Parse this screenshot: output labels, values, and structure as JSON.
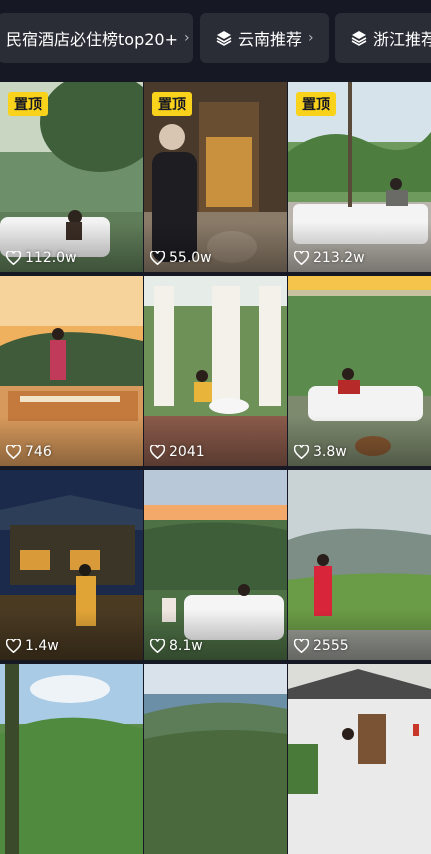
{
  "chips": [
    {
      "label": "民宿酒店必住榜top20+",
      "icon": "chevron-right-icon"
    },
    {
      "label": "云南推荐",
      "icon": "layers-icon"
    },
    {
      "label": "浙江推荐",
      "icon": "layers-icon"
    }
  ],
  "pinned_label": "置顶",
  "tiles": [
    {
      "likes": "112.0w",
      "pinned": true
    },
    {
      "likes": "55.0w",
      "pinned": true
    },
    {
      "likes": "213.2w",
      "pinned": true
    },
    {
      "likes": "746",
      "pinned": false
    },
    {
      "likes": "2041",
      "pinned": false
    },
    {
      "likes": "3.8w",
      "pinned": false
    },
    {
      "likes": "1.4w",
      "pinned": false
    },
    {
      "likes": "8.1w",
      "pinned": false
    },
    {
      "likes": "2555",
      "pinned": false
    },
    {
      "likes": "",
      "pinned": false
    },
    {
      "likes": "",
      "pinned": false
    },
    {
      "likes": "",
      "pinned": false
    }
  ]
}
